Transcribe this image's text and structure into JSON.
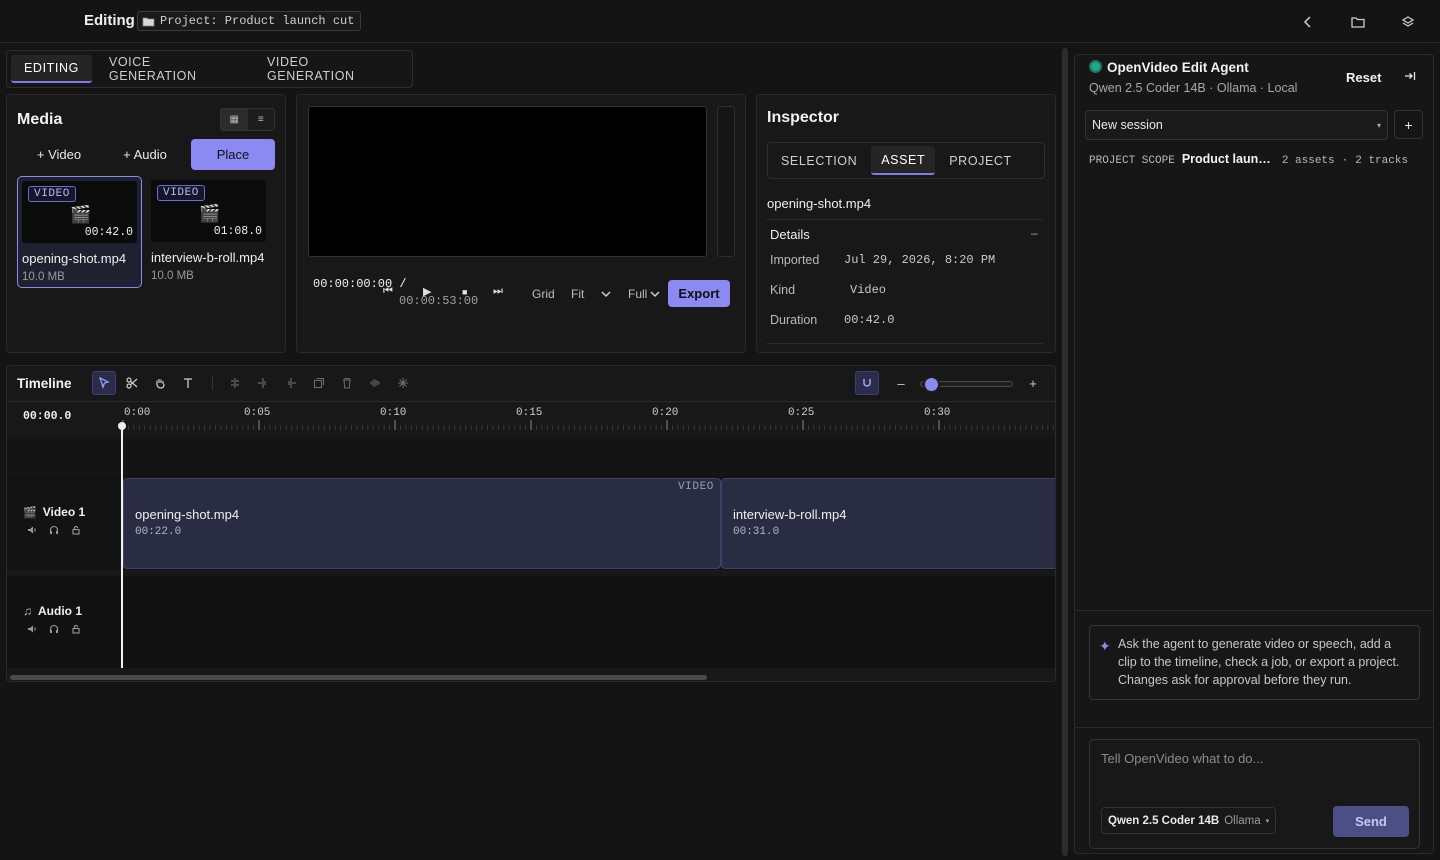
{
  "topbar": {
    "title": "Editing",
    "project_chip": "Project: Product launch cut",
    "project_icon": "folder-icon",
    "icons": [
      "chevron-left-icon",
      "folder-icon",
      "layers-icon"
    ]
  },
  "editor_tabs": [
    {
      "label": "EDITING",
      "active": true
    },
    {
      "label": "VOICE GENERATION",
      "active": false
    },
    {
      "label": "VIDEO GENERATION",
      "active": false
    }
  ],
  "media": {
    "title": "Media",
    "view_grid": "▦",
    "view_list": "≡",
    "add_video": "+ Video",
    "add_audio": "+ Audio",
    "place": "Place",
    "assets": [
      {
        "badge": "VIDEO",
        "icon": "🎬",
        "duration": "00:42.0",
        "name": "opening-shot.mp4",
        "size": "10.0 MB",
        "selected": true
      },
      {
        "badge": "VIDEO",
        "icon": "🎬",
        "duration": "01:08.0",
        "name": "interview-b-roll.mp4",
        "size": "10.0 MB",
        "selected": false
      }
    ]
  },
  "preview": {
    "current_time": "00:00:00:00 /",
    "total_time": "00:00:53:00",
    "controls": [
      "⏮",
      "▶",
      "■",
      "⏭"
    ],
    "grid": "Grid",
    "fit": "Fit",
    "full": "Full",
    "export": "Export"
  },
  "inspector": {
    "title": "Inspector",
    "tabs": [
      {
        "label": "SELECTION",
        "active": false
      },
      {
        "label": "ASSET",
        "active": true
      },
      {
        "label": "PROJECT",
        "active": false
      }
    ],
    "file_name": "opening-shot.mp4",
    "section": "Details",
    "collapse": "–",
    "rows": [
      {
        "label": "Imported",
        "value": "Jul 29, 2026, 8:20 PM"
      },
      {
        "label": "Kind",
        "value": "Video"
      },
      {
        "label": "Duration",
        "value": "00:42.0"
      }
    ]
  },
  "timeline": {
    "title": "Timeline",
    "current_time": "00:00.0",
    "ticks": [
      "0:00",
      "0:05",
      "0:10",
      "0:15",
      "0:20",
      "0:25",
      "0:30"
    ],
    "zoom_minus": "–",
    "zoom_plus": "+",
    "zoom_level": 0.1,
    "tracks": [
      {
        "name": "Video 1",
        "icon": "🎬"
      },
      {
        "name": "Audio 1",
        "icon": "♫"
      }
    ],
    "clips": [
      {
        "name": "opening-shot.mp4",
        "duration": "00:22.0",
        "tag": "VIDEO"
      },
      {
        "name": "interview-b-roll.mp4",
        "duration": "00:31.0",
        "tag": ""
      }
    ]
  },
  "agent": {
    "title": "OpenVideo Edit Agent",
    "model_line": "Qwen 2.5 Coder 14B · Ollama · Local",
    "reset": "Reset",
    "session": "New session",
    "session_add": "+",
    "scope_label": "PROJECT SCOPE",
    "scope_project": "Product launch cut",
    "scope_assets": "2 assets",
    "scope_sep": "·",
    "scope_tracks": "2 tracks",
    "hint": "Ask the agent to generate video or speech, add a clip to the timeline, check a job, or export a project. Changes ask for approval before they run.",
    "prompt_placeholder": "Tell OpenVideo what to do...",
    "model_pill": "Qwen 2.5 Coder 14B",
    "model_provider": "Ollama",
    "send": "Send"
  },
  "colors": {
    "accent": "#8a8af2",
    "background": "#141414",
    "status_online": "#1aa98a"
  }
}
